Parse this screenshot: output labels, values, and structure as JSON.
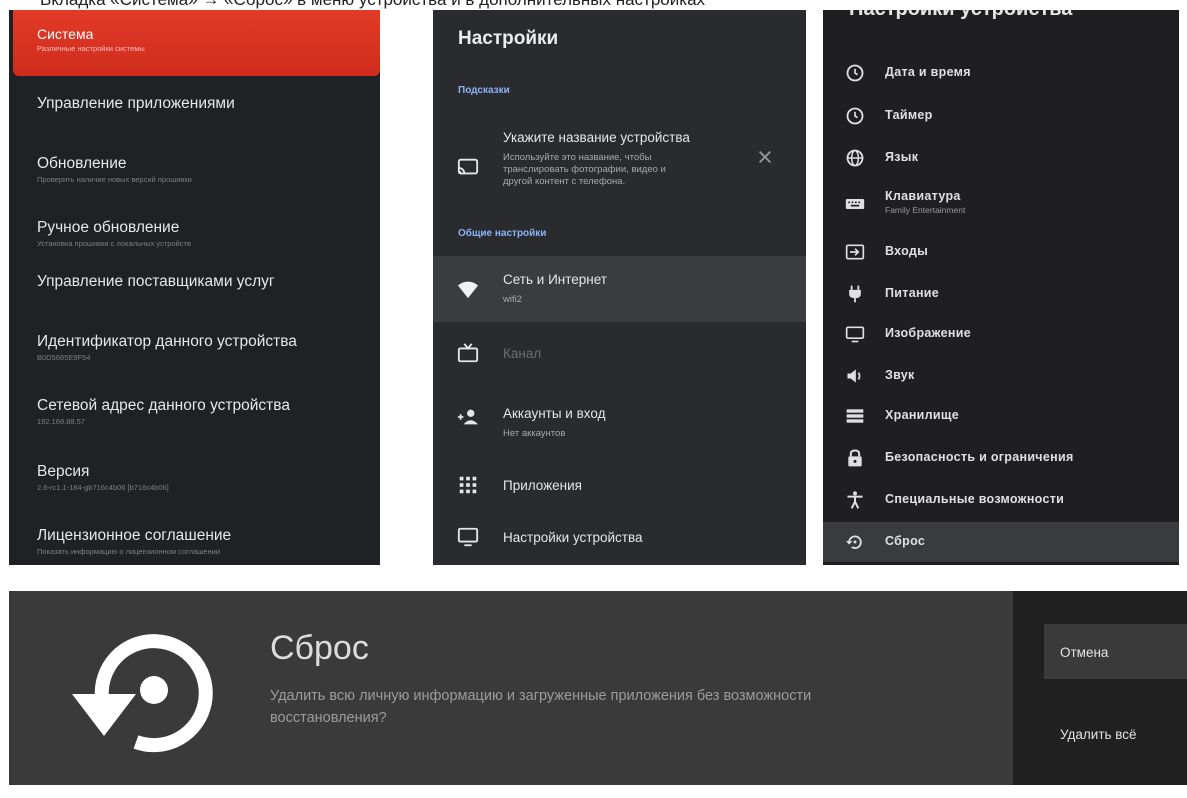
{
  "top_crop_text": "Вкладка «Система» → «Сброс» в меню устройства и в дополнительных настройках",
  "panel_system": {
    "header": {
      "title": "Система",
      "subtitle": "Различные настройки системы"
    },
    "items": [
      {
        "title": "Управление приложениями",
        "subtitle": ""
      },
      {
        "title": "Обновление",
        "subtitle": "Проверить наличие новых версий прошивки"
      },
      {
        "title": "Ручное обновление",
        "subtitle": "Установка прошивки с локальных устройств"
      },
      {
        "title": "Управление поставщиками услуг",
        "subtitle": ""
      },
      {
        "title": "Идентификатор данного устройства",
        "subtitle": "B0D5685E9F54"
      },
      {
        "title": "Сетевой адрес данного устройства",
        "subtitle": "192.168.88.57"
      },
      {
        "title": "Версия",
        "subtitle": "2.6-rc1.1-184-gb716c4b06 [b716c4b06]"
      },
      {
        "title": "Лицензионное соглашение",
        "subtitle": "Показать информацию о лицензионном соглашении"
      }
    ]
  },
  "panel_settings": {
    "title": "Настройки",
    "section_hints": "Подсказки",
    "hint": {
      "title": "Укажите название устройства",
      "line1": "Используйте это название, чтобы",
      "line2": "транслировать фотографии, видео и",
      "line3": "другой контент с телефона."
    },
    "section_general": "Общие настройки",
    "items": [
      {
        "title": "Сеть и Интернет",
        "subtitle": "wifi2",
        "icon": "wifi-icon"
      },
      {
        "title": "Канал",
        "subtitle": "",
        "icon": "tv-icon"
      },
      {
        "title": "Аккаунты и вход",
        "subtitle": "Нет аккаунтов",
        "icon": "add-person-icon"
      },
      {
        "title": "Приложения",
        "subtitle": "",
        "icon": "apps-grid-icon"
      },
      {
        "title": "Настройки устройства",
        "subtitle": "",
        "icon": "monitor-icon"
      }
    ]
  },
  "panel_device": {
    "title": "Настройки устройства",
    "items": [
      {
        "title": "Дата и время",
        "subtitle": "",
        "icon": "clock-icon"
      },
      {
        "title": "Таймер",
        "subtitle": "",
        "icon": "timer-icon"
      },
      {
        "title": "Язык",
        "subtitle": "",
        "icon": "globe-icon"
      },
      {
        "title": "Клавиатура",
        "subtitle": "Family Entertainment",
        "icon": "keyboard-icon"
      },
      {
        "title": "Входы",
        "subtitle": "",
        "icon": "input-icon"
      },
      {
        "title": "Питание",
        "subtitle": "",
        "icon": "power-plug-icon"
      },
      {
        "title": "Изображение",
        "subtitle": "",
        "icon": "display-icon"
      },
      {
        "title": "Звук",
        "subtitle": "",
        "icon": "speaker-icon"
      },
      {
        "title": "Хранилище",
        "subtitle": "",
        "icon": "storage-icon"
      },
      {
        "title": "Безопасность и ограничения",
        "subtitle": "",
        "icon": "lock-icon"
      },
      {
        "title": "Специальные возможности",
        "subtitle": "",
        "icon": "accessibility-icon"
      },
      {
        "title": "Сброс",
        "subtitle": "",
        "icon": "reset-icon"
      }
    ]
  },
  "reset_dialog": {
    "title": "Сброс",
    "description": "Удалить всю личную информацию и загруженные приложения без возможности восстановления?",
    "cancel_label": "Отмена",
    "confirm_label": "Удалить всё"
  },
  "colors": {
    "accent_red": "#e23a28",
    "section_blue": "#8ab4f8"
  }
}
